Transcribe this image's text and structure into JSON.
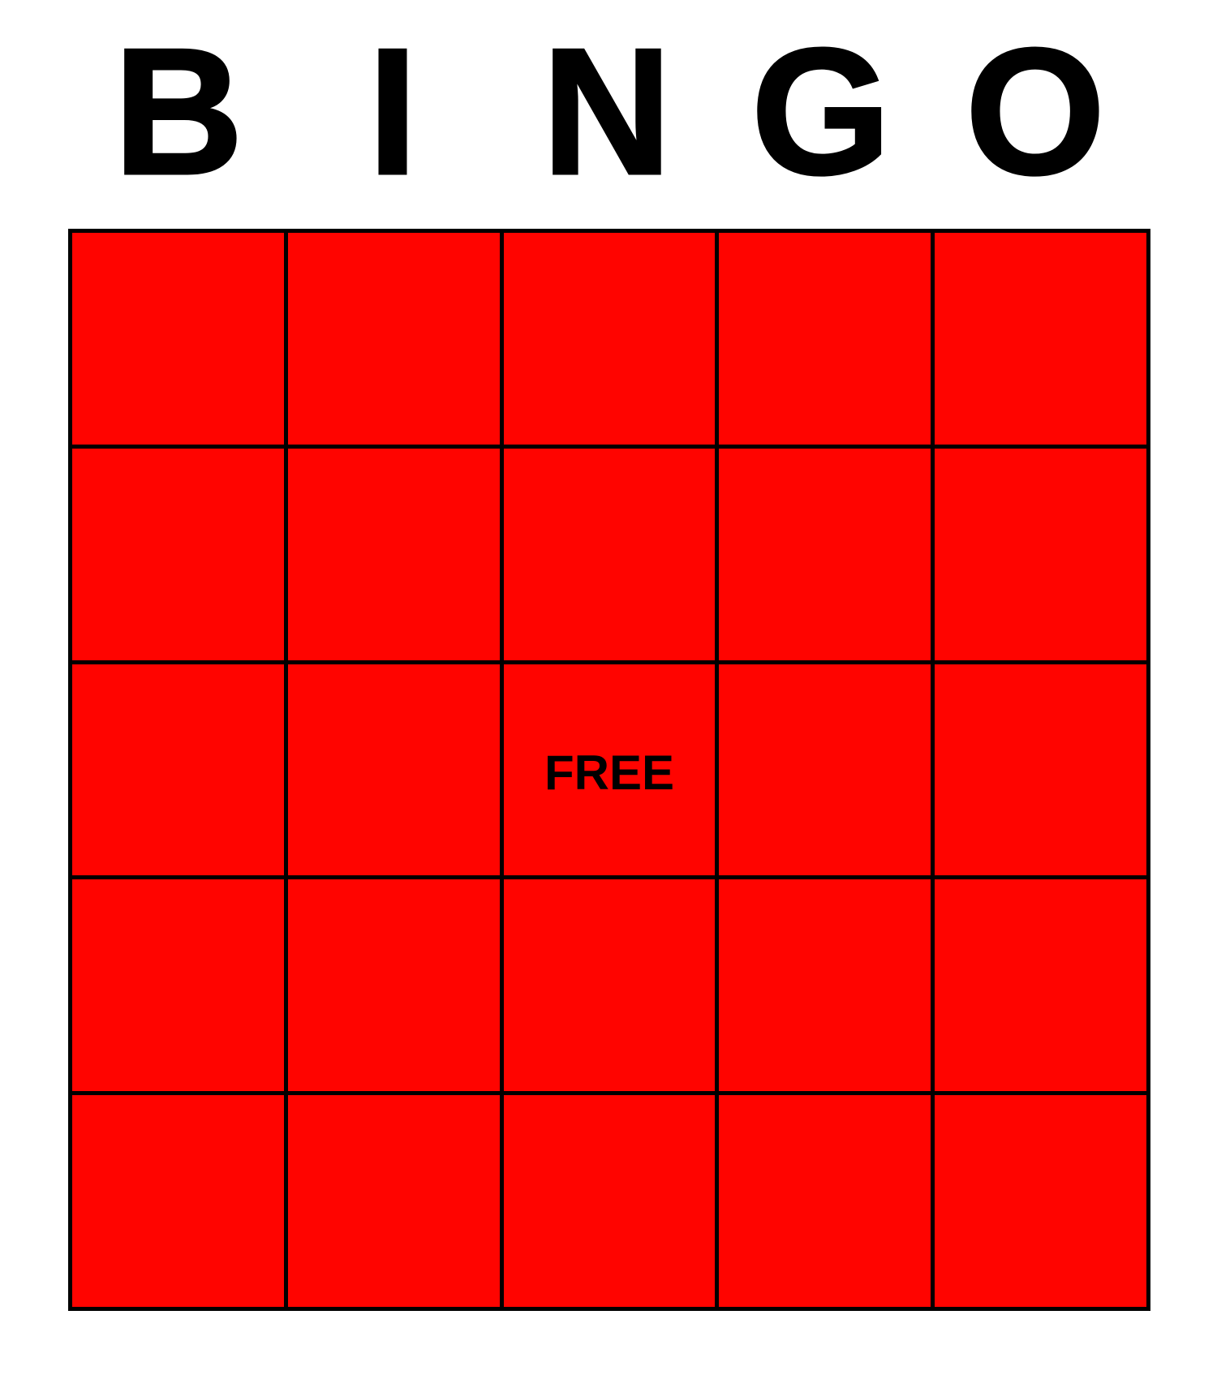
{
  "header": {
    "letters": [
      "B",
      "I",
      "N",
      "G",
      "O"
    ]
  },
  "card": {
    "rows": [
      [
        "",
        "",
        "",
        "",
        ""
      ],
      [
        "",
        "",
        "",
        "",
        ""
      ],
      [
        "",
        "",
        "FREE",
        "",
        ""
      ],
      [
        "",
        "",
        "",
        "",
        ""
      ],
      [
        "",
        "",
        "",
        "",
        ""
      ]
    ]
  },
  "colors": {
    "cell_fill": "#ff0400",
    "grid_line": "#000000",
    "text": "#000000",
    "background": "#ffffff"
  }
}
